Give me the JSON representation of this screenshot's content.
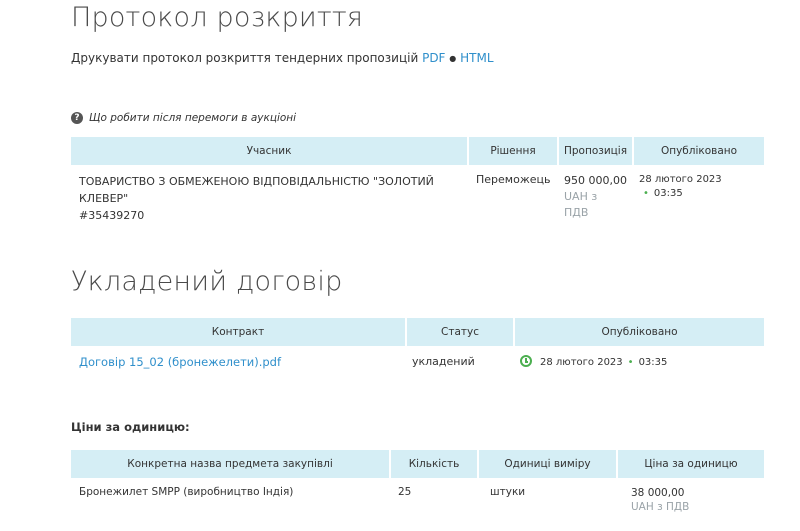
{
  "disclosure": {
    "title": "Протокол розкриття",
    "print_text": "Друкувати протокол розкриття тендерних пропозицій",
    "pdf_link": "PDF",
    "separator": "●",
    "html_link": "HTML",
    "help_text": "Що робити після перемоги в аукціоні",
    "columns": [
      "Учасник",
      "Рішення",
      "Пропозиція",
      "Опубліковано"
    ],
    "rows": [
      {
        "participant": "ТОВАРИСТВО З ОБМЕЖЕНОЮ ВІДПОВІДАЛЬНІСТЮ \"ЗОЛОТИЙ КЛЕВЕР\"",
        "edrpou": "#35439270",
        "decision": "Переможець",
        "amount": "950 000,00",
        "currency_note": "UAH з ПДВ",
        "date": "28 лютого 2023",
        "time": "03:35"
      }
    ]
  },
  "contract": {
    "title": "Укладений договір",
    "columns": [
      "Контракт",
      "Статус",
      "Опубліковано"
    ],
    "rows": [
      {
        "file": "Договір 15_02 (бронежелети).pdf",
        "status": "укладений",
        "date": "28 лютого 2023",
        "time": "03:35"
      }
    ]
  },
  "unit_prices": {
    "label": "Ціни за одиницю:",
    "columns": [
      "Конкретна назва предмета закупівлі",
      "Кількість",
      "Одиниці виміру",
      "Ціна за одиницю"
    ],
    "rows": [
      {
        "item": "Бронежилет SMPP (виробництво Індія)",
        "quantity": "25",
        "unit": "штуки",
        "price": "38 000,00",
        "currency_note": "UAH з ПДВ"
      }
    ]
  },
  "colors": {
    "header_bg": "#d5eef5",
    "link": "#2f8fcb",
    "accent_green": "#4caf50"
  }
}
